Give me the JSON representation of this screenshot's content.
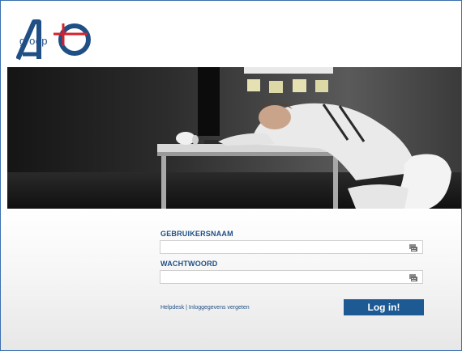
{
  "brand": {
    "logo_text": "groep",
    "colors": {
      "navy": "#1f4f85",
      "red": "#d8202a",
      "button": "#1d5a94",
      "frame": "#3b6fb0"
    }
  },
  "login": {
    "username_label": "GEBRUIKERSNAAM",
    "username_value": "",
    "password_label": "WACHTWOORD",
    "password_value": "",
    "helpdesk_link": "Helpdesk",
    "separator": "|",
    "forgot_link": "Inloggegevens vergeten",
    "submit_label": "Log in!",
    "field_icon": "keyboard-icon"
  }
}
